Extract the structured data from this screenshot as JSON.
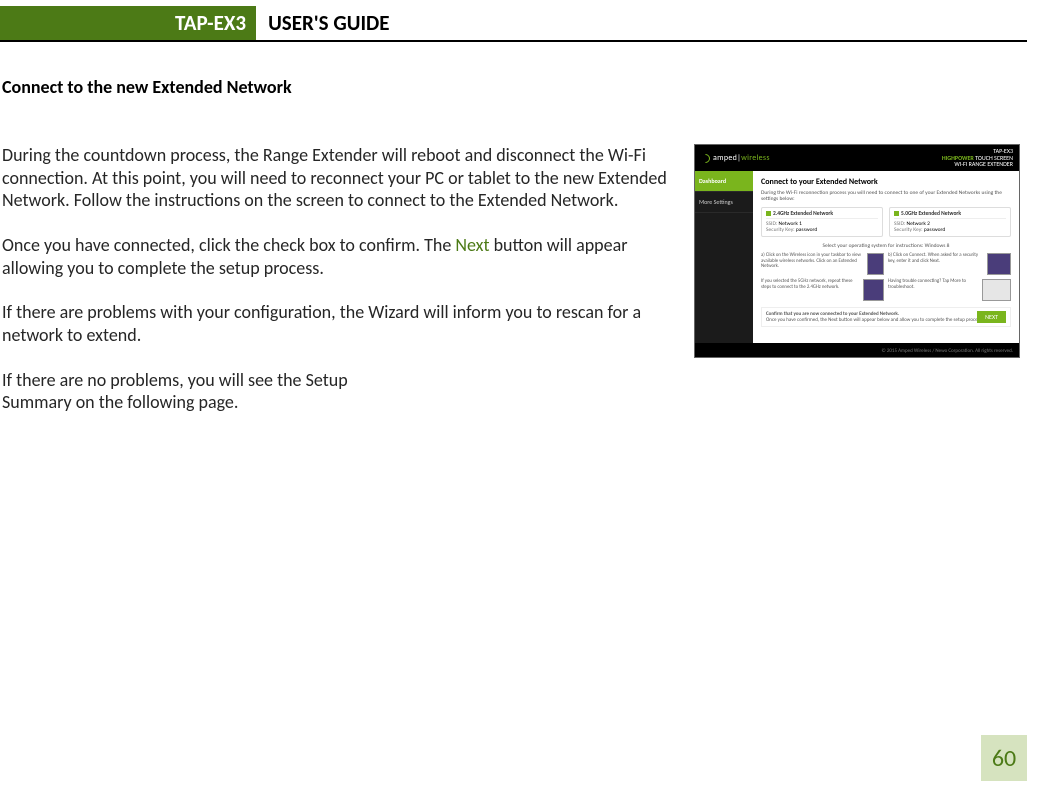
{
  "header": {
    "product": "TAP-EX3",
    "title": "USER'S GUIDE"
  },
  "section_heading": "Connect to the new Extended Network",
  "body": {
    "p1": "During the countdown process, the Range Extender will reboot and disconnect the Wi-Fi connection. At this point, you will need to reconnect your PC or tablet to the new Extended Network. Follow the instructions on the screen to connect to the Extended Network.",
    "p2a": "Once you have connected, click the check box to confirm. The ",
    "p2_next": "Next",
    "p2b": " button will appear allowing you to complete the setup process.",
    "p3": "If there are problems with your configuration, the Wizard will inform you to rescan for a network to extend.",
    "p4a": "If there are no problems, you will see the Setup",
    "p4b": "Summary on the following page."
  },
  "figure": {
    "brand_a": "amped",
    "brand_b": "wireless",
    "model_line1": "TAP-EX3",
    "model_line2a": "HIGHPOWER",
    "model_line2b": " TOUCH SCREEN",
    "model_line3": "WI-FI RANGE EXTENDER",
    "side_dashboard": "Dashboard",
    "side_more": "More Settings",
    "main_title": "Connect to your Extended Network",
    "subtitle": "During the Wi-Fi reconnection process you will need to connect to one of your Extended Networks using the settings below:",
    "net24_h": "2.4GHz Extended Network",
    "net5_h": "5.0GHz Extended Network",
    "ssid_lbl": "SSID:",
    "key_lbl": "Security Key:",
    "ssid1": "Network 1",
    "key1": "password",
    "ssid2": "Network 2",
    "key2": "password",
    "os_row": "Select your operating system for instructions:   Windows 8",
    "tile1": "a) Click on the Wireless icon in your taskbar to view available wireless networks. Click on an Extended Network.",
    "tile2": "b) Click on Connect. When asked for a security key, enter it and click Next.",
    "tile3": "If you selected the 5GHz network, repeat these steps to connect to the 2.4GHz network.",
    "tile4": "Having trouble connecting? Tap More to troubleshoot.",
    "confirm_title": "Confirm that you are now connected to your Extended Network.",
    "confirm_sub": "Once you have confirmed, the Next button will appear below and allow you to complete the setup process.",
    "next_btn": "NEXT",
    "footer": "© 2015 Amped Wireless / Newo Corporation. All rights reserved."
  },
  "page_number": "60"
}
